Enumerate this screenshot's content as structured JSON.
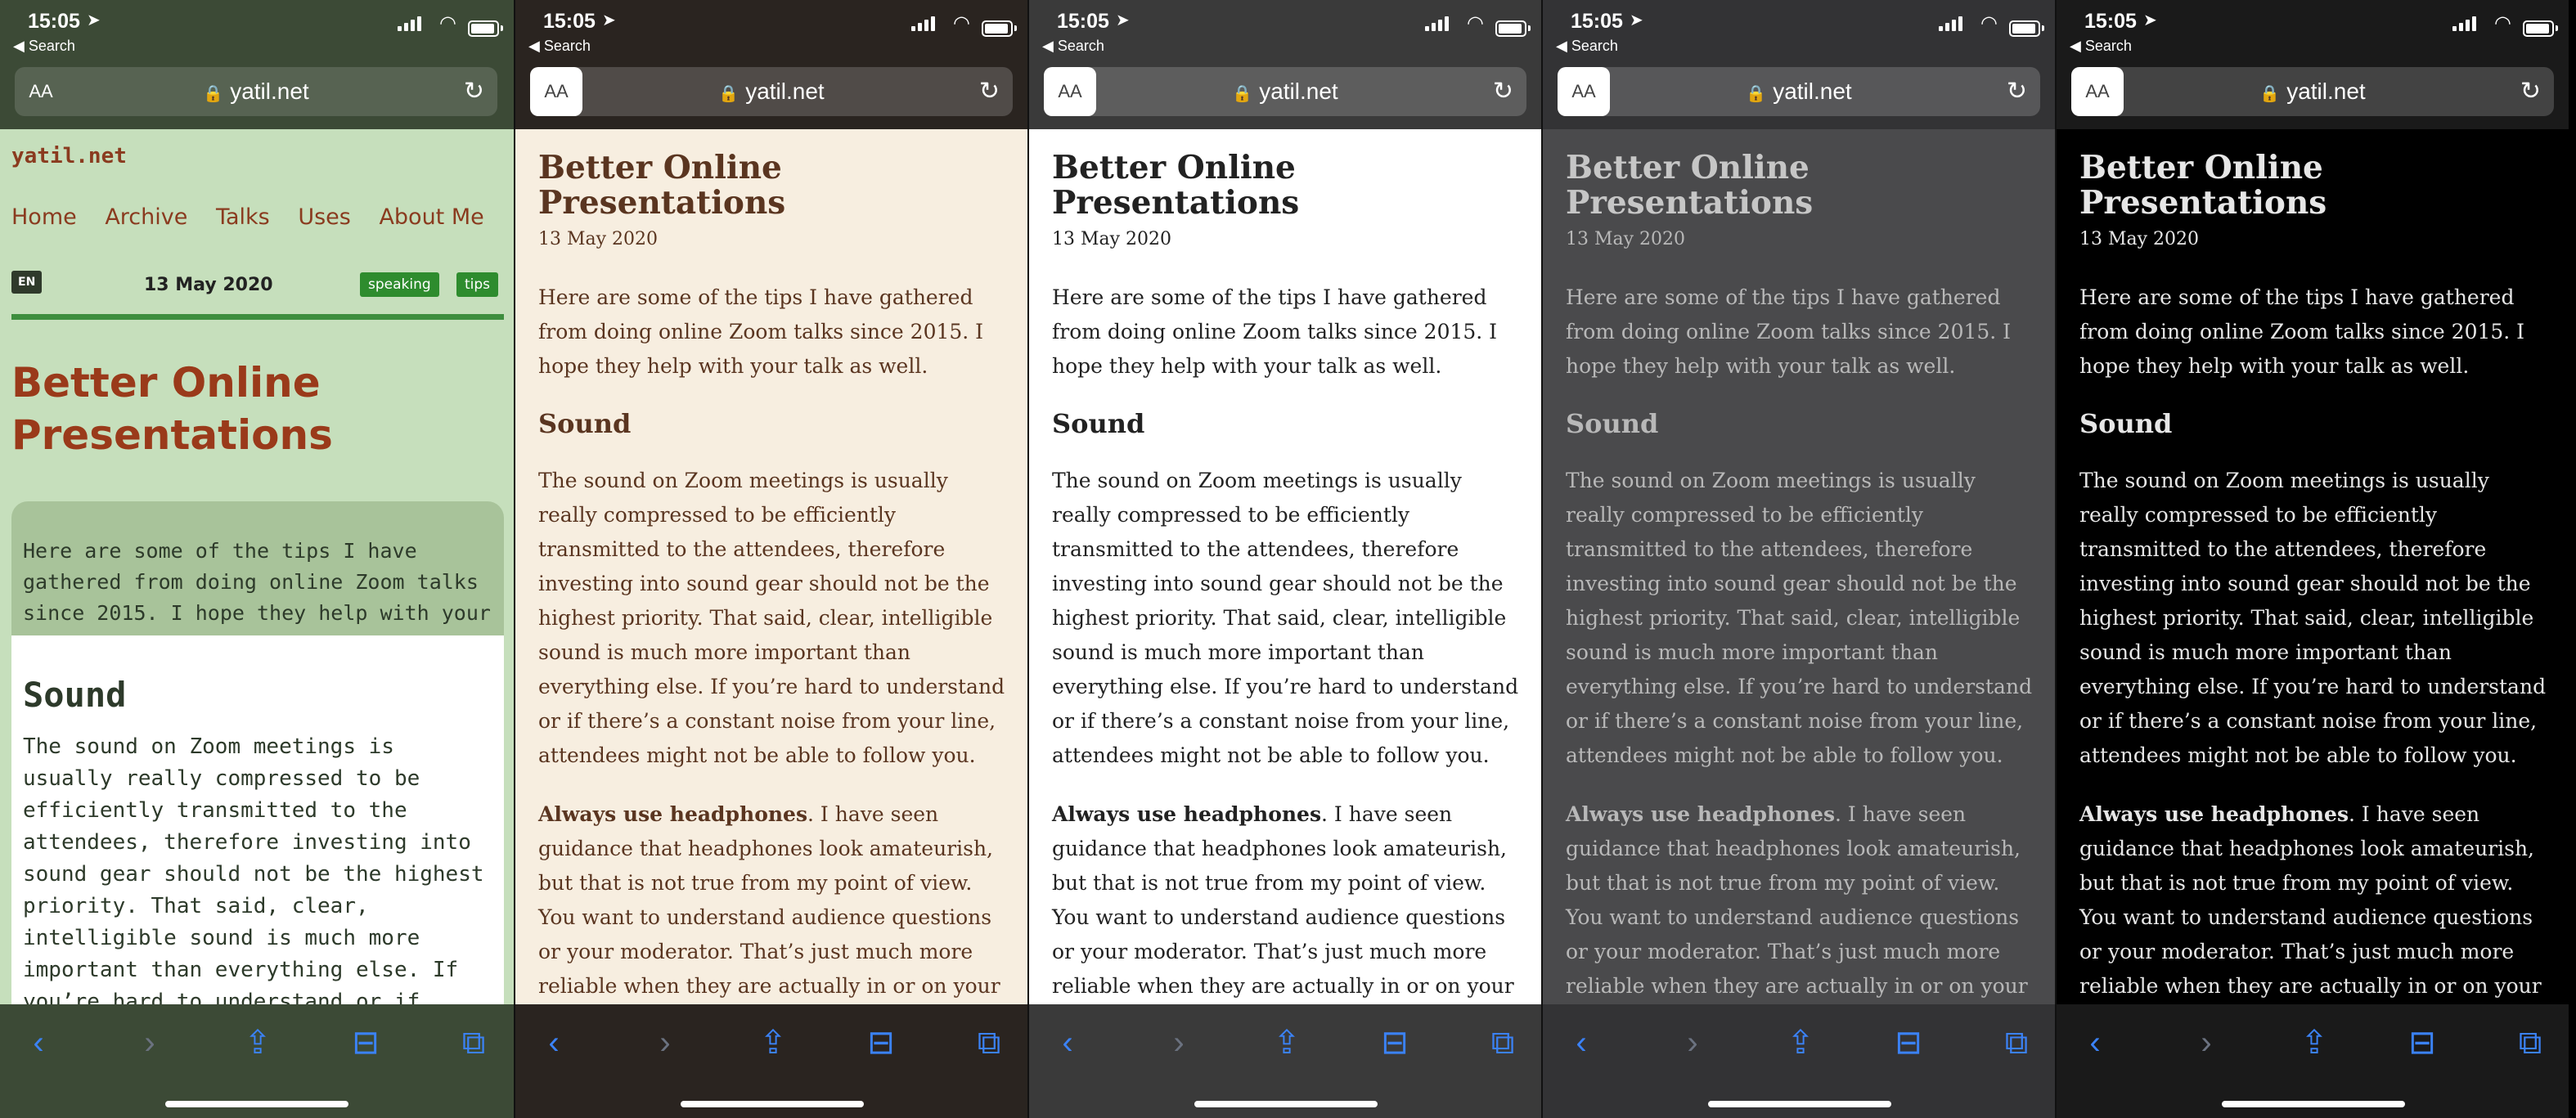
{
  "status": {
    "time": "15:05",
    "back_label": "◀ Search"
  },
  "browser": {
    "url": "yatil.net",
    "aa_label": "AA"
  },
  "post": {
    "title": "Better Online Presentations",
    "date": "13 May 2020",
    "intro": "Here are some of the tips I have gathered from doing online Zoom talks since 2015. I hope they help with your talk as well.",
    "section_heading": "Sound",
    "sound_paragraph": "The sound on Zoom meetings is usually really compressed to be efficiently transmitted to the attendees, therefore investing into sound gear should not be the highest priority. That said, clear, intelligible sound is much more important than everything else. If you’re hard to understand or if there’s a constant noise from your line, attendees might not be able to follow you.",
    "headphones_strong": "Always use headphones",
    "headphones_rest": ". I have seen guidance that headphones look amateurish, but that is not true from my point of view. You want to understand audience questions or your moderator. That’s just much more reliable when they are actually in or on your ears."
  },
  "site": {
    "name": "yatil.net",
    "nav": [
      "Home",
      "Archive",
      "Talks",
      "Uses",
      "About Me"
    ],
    "lang_badge": "EN",
    "tags": [
      "speaking",
      "tips"
    ]
  },
  "themes": [
    "green",
    "sepia",
    "light",
    "gray",
    "dark"
  ]
}
